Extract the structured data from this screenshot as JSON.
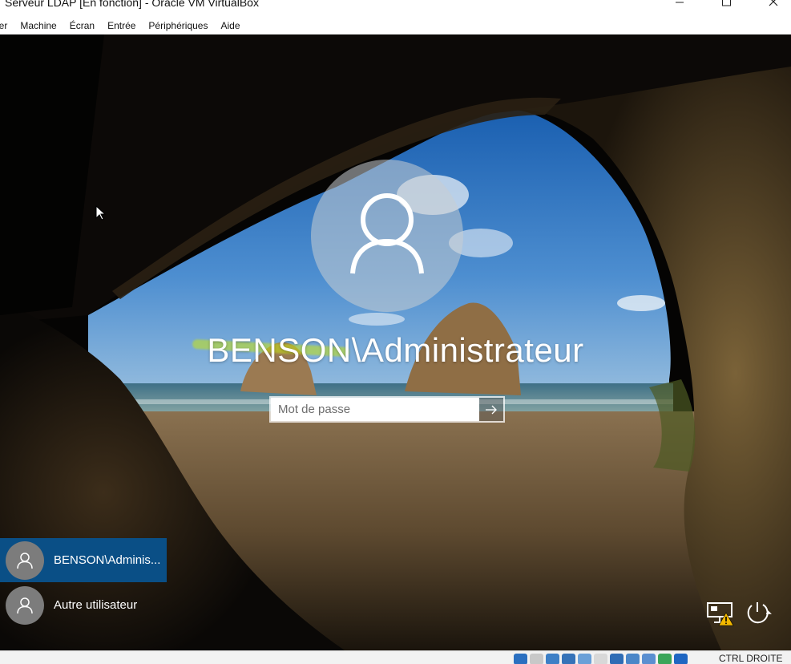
{
  "window": {
    "title": "Serveur LDAP [En fonction] - Oracle VM VirtualBox"
  },
  "menubar": {
    "items": [
      "ier",
      "Machine",
      "Écran",
      "Entrée",
      "Périphériques",
      "Aide"
    ]
  },
  "login": {
    "username": "BENSON\\Administrateur",
    "password_placeholder": "Mot de passe",
    "password_value": ""
  },
  "user_list": [
    {
      "label": "BENSON\\Adminis...",
      "selected": true
    },
    {
      "label": "Autre utilisateur",
      "selected": false
    }
  ],
  "system_icons": [
    "network-warning-icon",
    "power-icon"
  ],
  "statusbar": {
    "host_key": "CTRL DROITE",
    "icons": [
      "hdd-icon",
      "optical-icon",
      "audio-icon",
      "network-icon",
      "usb-icon",
      "shared-folder-icon",
      "display-icon",
      "recording-icon",
      "vt-icon",
      "cpu-icon",
      "mouse-integration-icon",
      "keyboard-icon"
    ]
  },
  "colors": {
    "selected_user_bg": "#0a4f86",
    "highlight_marker": "#c8e614"
  }
}
